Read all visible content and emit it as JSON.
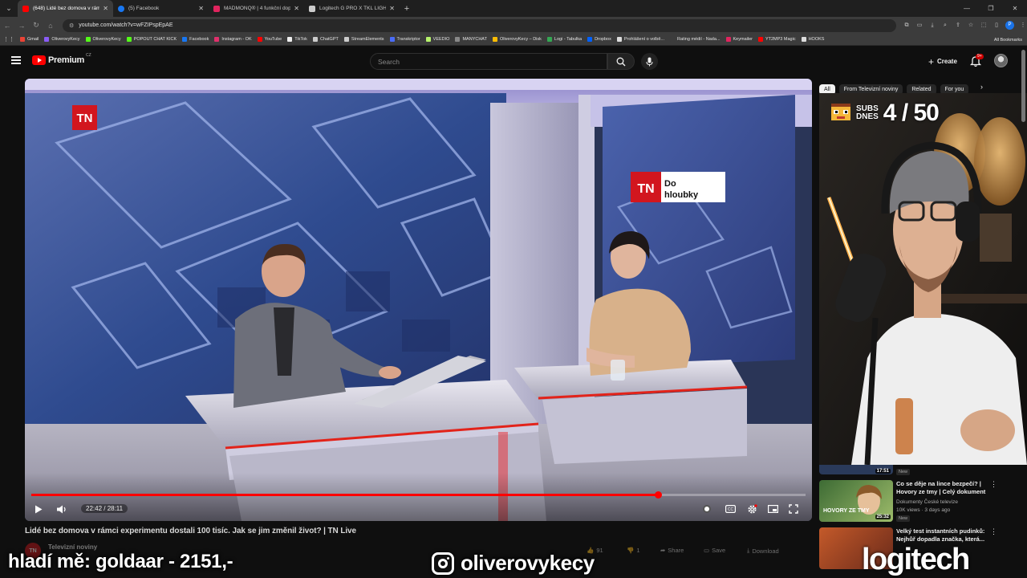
{
  "browser": {
    "tabs": [
      {
        "title": "(648) Lidé bez domova v rámci",
        "active": true,
        "favicon_color": "#ff0000"
      },
      {
        "title": "(5) Facebook",
        "active": false,
        "favicon_color": "#1877f2"
      },
      {
        "title": "MADMONQ® | 4 funkční doplň",
        "active": false,
        "favicon_color": "#e0245e"
      },
      {
        "title": "Logitech G PRO X TKL LIGHTSP",
        "active": false,
        "favicon_color": "#cccccc"
      }
    ],
    "url": "youtube.com/watch?v=wFZIPspEpAE",
    "bookmarks": [
      {
        "label": "Gmail",
        "color": "#ea4335"
      },
      {
        "label": "OliverovyKecy",
        "color": "#8a5cf6"
      },
      {
        "label": "OliverovyKecy",
        "color": "#53fc18"
      },
      {
        "label": "POPOUT CHAT KICK",
        "color": "#53fc18"
      },
      {
        "label": "Facebook",
        "color": "#1877f2"
      },
      {
        "label": "Instagram - OK",
        "color": "#e1306c"
      },
      {
        "label": "YouTube",
        "color": "#ff0000"
      },
      {
        "label": "TikTok",
        "color": "#eeeeee"
      },
      {
        "label": "ChatGPT",
        "color": "#cccccc"
      },
      {
        "label": "StreamElements",
        "color": "#cccccc"
      },
      {
        "label": "Transkriptor",
        "color": "#4a6cf7"
      },
      {
        "label": "VEEDIO",
        "color": "#b6f36b"
      },
      {
        "label": "MANYCHAT",
        "color": "#888888"
      },
      {
        "label": "OliverovyKecy – Disk",
        "color": "#fbbc04"
      },
      {
        "label": "Logi - Tabulka",
        "color": "#34a853"
      },
      {
        "label": "Dropbox",
        "color": "#0061ff"
      },
      {
        "label": "Prohlášení o volbě...",
        "color": "#dddddd"
      },
      {
        "label": "Rating médií - Nada...",
        "color": "#3c3c3c"
      },
      {
        "label": "Keymailer",
        "color": "#e0245e"
      },
      {
        "label": "YT2MP3 Magic",
        "color": "#ff0000"
      },
      {
        "label": "HOOKS",
        "color": "#dddddd"
      }
    ],
    "all_bookmarks": "All Bookmarks",
    "profile_initial": "P"
  },
  "youtube": {
    "logo_text": "Premium",
    "country": "CZ",
    "search_placeholder": "Search",
    "create_label": "Create",
    "notif_count": "9+",
    "video": {
      "title": "Lidé bez domova v rámci experimentu dostali 100 tisíc. Jak se jim změnil život? | TN Live",
      "time": "22:42 / 28:11",
      "progress": 0.81,
      "channel": "Televizní noviny",
      "channel_badge": "TN",
      "likes": "91",
      "dislikes": "1",
      "share": "Share",
      "save": "Save",
      "download": "Download",
      "studio_logo": "TN",
      "screen_logo_line1": "Do",
      "screen_logo_line2": "hloubky"
    },
    "chips": [
      "All",
      "From Televizní noviny",
      "Related",
      "For you"
    ],
    "recs": [
      {
        "duration": "17:51",
        "badge": "New"
      },
      {
        "title": "Co se děje na lince bezpečí? | Hovory ze tmy | Celý dokument",
        "channel": "Dokumenty České televize",
        "meta": "10K views · 3 days ago",
        "badge": "New",
        "duration": "25:32",
        "thumb_text": "HOVORY ZE TMY"
      },
      {
        "title": "Velký test instantních pudinků: Nejhůř dopadla značka, která...",
        "duration": ""
      }
    ]
  },
  "overlay": {
    "left_text": "hladí mě: goldaar - 2151,-",
    "instagram": "oliverovykecy",
    "brand": "logitech",
    "subs_label_1": "SUBS",
    "subs_label_2": "DNES",
    "subs_count": "4 / 50"
  }
}
